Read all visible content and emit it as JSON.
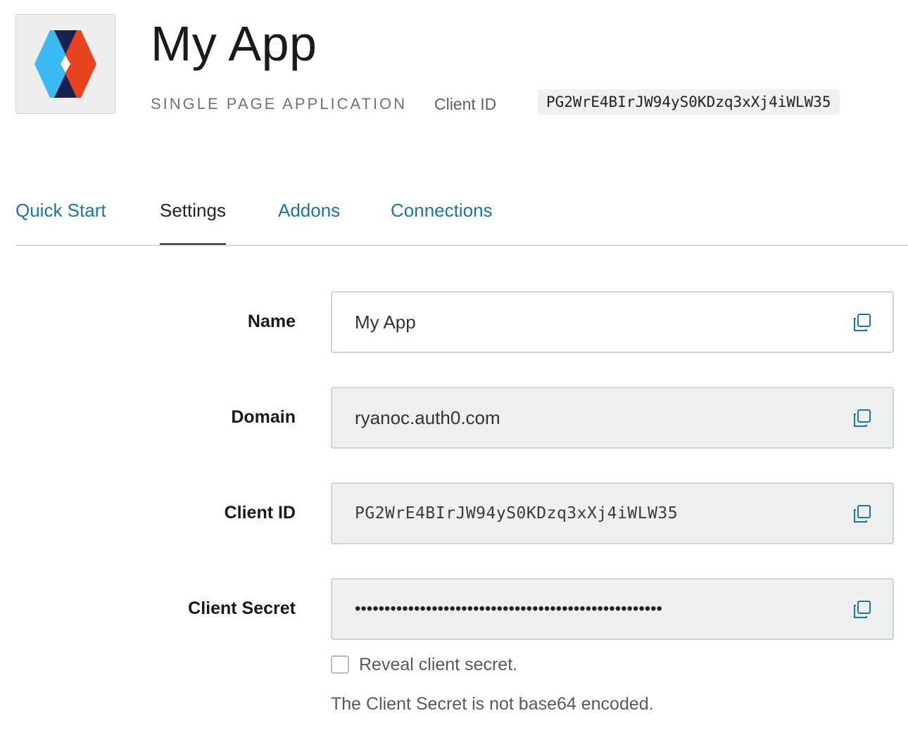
{
  "app": {
    "title": "My App",
    "type": "SINGLE PAGE APPLICATION",
    "client_id_label": "Client ID",
    "client_id": "PG2WrE4BIrJW94yS0KDzq3xXj4iWLW35",
    "logo_icon": "auth0-shield-logo",
    "colors": {
      "logo_blue": "#3bb9f2",
      "logo_orange": "#e8431f",
      "logo_navy": "#16214d",
      "link": "#1b73a6"
    }
  },
  "tabs": [
    {
      "label": "Quick Start",
      "active": false
    },
    {
      "label": "Settings",
      "active": true
    },
    {
      "label": "Addons",
      "active": false
    },
    {
      "label": "Connections",
      "active": false
    }
  ],
  "fields": {
    "name": {
      "label": "Name",
      "value": "My App"
    },
    "domain": {
      "label": "Domain",
      "value": "ryanoc.auth0.com"
    },
    "client_id": {
      "label": "Client ID",
      "value": "PG2WrE4BIrJW94yS0KDzq3xXj4iWLW35"
    },
    "client_secret": {
      "label": "Client Secret",
      "value": "••••••••••••••••••••••••••••••••••••••••••••••••••••"
    }
  },
  "copy_icon": "copy-icon",
  "reveal": {
    "label": "Reveal client secret.",
    "checked": false
  },
  "help_text": "The Client Secret is not base64 encoded."
}
